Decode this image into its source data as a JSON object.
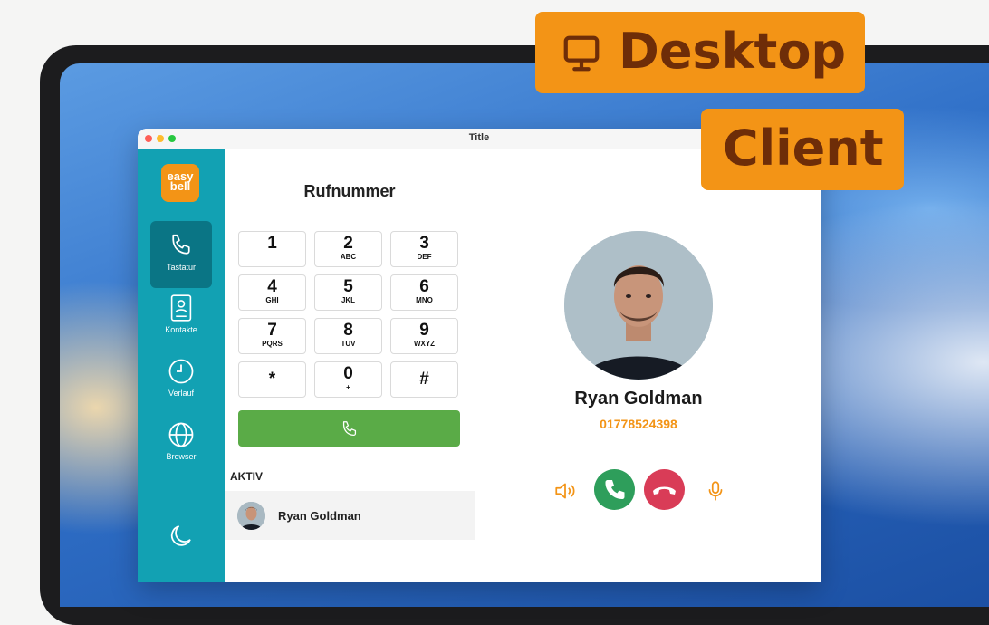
{
  "window": {
    "title": "Title"
  },
  "sidebar": {
    "logo": {
      "line1": "easy",
      "line2": "bell"
    },
    "items": [
      {
        "label": "Tastatur",
        "icon": "phone-icon",
        "active": true
      },
      {
        "label": "Kontakte",
        "icon": "contact-book-icon",
        "active": false
      },
      {
        "label": "Verlauf",
        "icon": "clock-icon",
        "active": false
      },
      {
        "label": "Browser",
        "icon": "globe-icon",
        "active": false
      }
    ],
    "bottom_icon": "moon-icon"
  },
  "dialpad": {
    "title": "Rufnummer",
    "keys": [
      {
        "digit": "1",
        "letters": ""
      },
      {
        "digit": "2",
        "letters": "ABC"
      },
      {
        "digit": "3",
        "letters": "DEF"
      },
      {
        "digit": "4",
        "letters": "GHI"
      },
      {
        "digit": "5",
        "letters": "JKL"
      },
      {
        "digit": "6",
        "letters": "MNO"
      },
      {
        "digit": "7",
        "letters": "PQRS"
      },
      {
        "digit": "8",
        "letters": "TUV"
      },
      {
        "digit": "9",
        "letters": "WXYZ"
      },
      {
        "digit": "*",
        "letters": ""
      },
      {
        "digit": "0",
        "letters": "+"
      },
      {
        "digit": "#",
        "letters": ""
      }
    ],
    "call_button_icon": "phone-icon"
  },
  "active_section": {
    "title": "AKTIV",
    "calls": [
      {
        "name": "Ryan Goldman"
      }
    ]
  },
  "contact": {
    "name": "Ryan Goldman",
    "number": "01778524398"
  },
  "controls": {
    "speaker_icon": "speaker-icon",
    "accept_icon": "phone-accept-icon",
    "hangup_icon": "phone-hangup-icon",
    "mic_icon": "microphone-icon"
  },
  "badges": {
    "desktop": "Desktop",
    "client": "Client"
  },
  "colors": {
    "sidebar": "#12a1b3",
    "sidebar_active": "#0a7585",
    "accent": "#f39416",
    "call_green": "#5aab47",
    "accept_green": "#2e9e5b",
    "hangup_red": "#d93c57"
  }
}
